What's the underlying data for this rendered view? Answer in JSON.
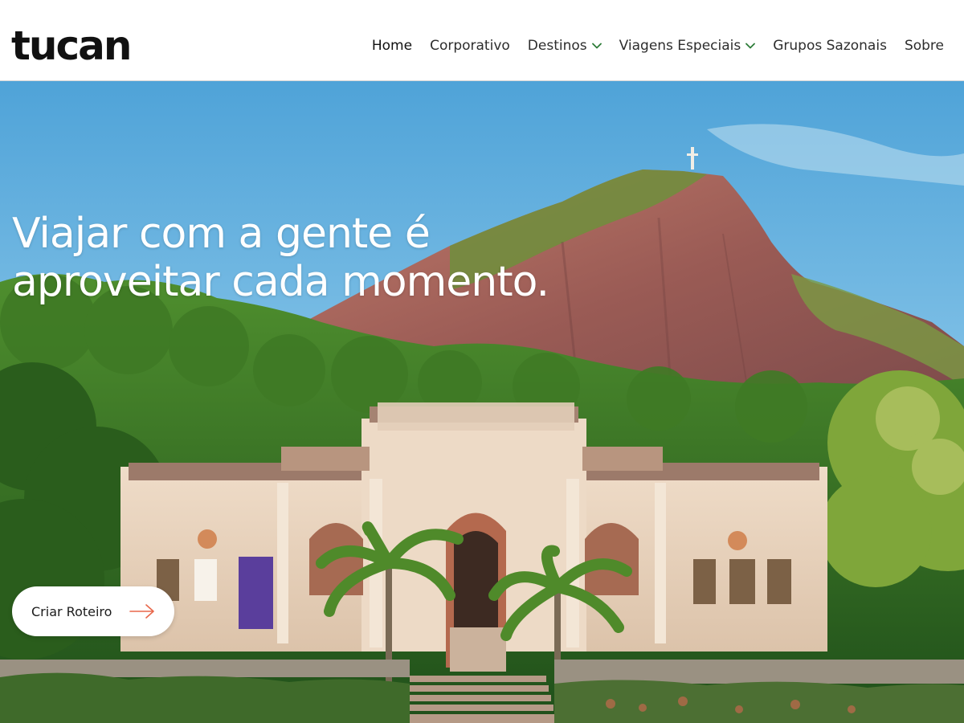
{
  "brand": {
    "name": "tucan"
  },
  "nav": {
    "items": [
      {
        "label": "Home",
        "dropdown": false,
        "active": true
      },
      {
        "label": "Corporativo",
        "dropdown": false,
        "active": false
      },
      {
        "label": "Destinos",
        "dropdown": true,
        "active": false
      },
      {
        "label": "Viagens Especiais",
        "dropdown": true,
        "active": false
      },
      {
        "label": "Grupos Sazonais",
        "dropdown": false,
        "active": false
      },
      {
        "label": "Sobre",
        "dropdown": false,
        "active": false
      }
    ]
  },
  "hero": {
    "headline_line1": "Viajar com a gente é",
    "headline_line2": "aproveitar cada momento.",
    "cta_label": "Criar Roteiro"
  },
  "colors": {
    "accent": "#e8674a",
    "chevron": "#2f7d3a",
    "text_dark": "#111111"
  },
  "icons": {
    "dropdown": "chevron-down-icon",
    "cta": "arrow-right-icon"
  }
}
